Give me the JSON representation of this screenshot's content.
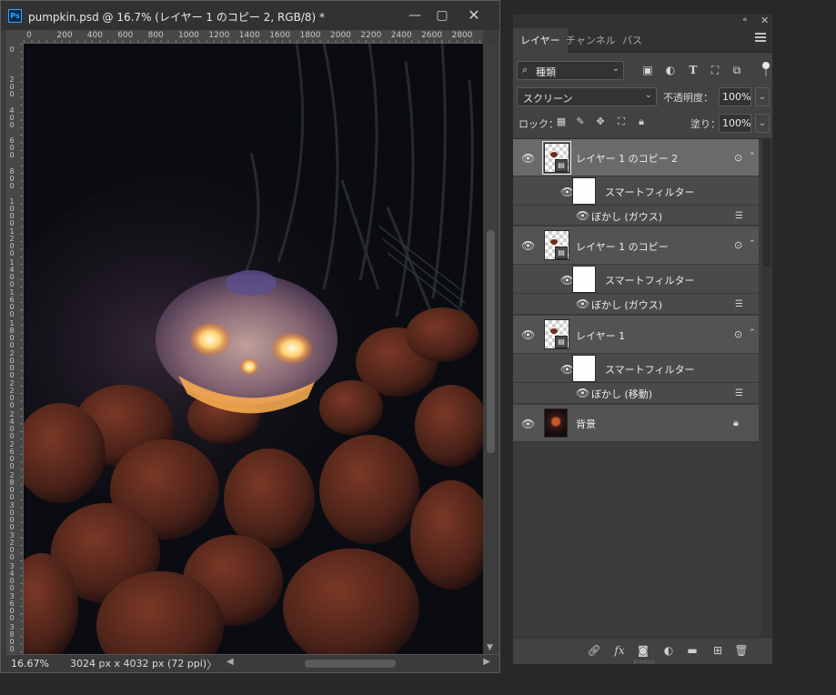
{
  "document": {
    "title": "pumpkin.psd @ 16.7% (レイヤー 1 のコピー 2, RGB/8) *",
    "app_icon": "Ps",
    "window_buttons": {
      "minimize": "—",
      "maximize": "▢",
      "close": "✕"
    },
    "ruler_h_labels": [
      "0",
      "200",
      "400",
      "600",
      "800",
      "1000",
      "1200",
      "1400",
      "1600",
      "1800",
      "2000",
      "2200",
      "2400",
      "2600",
      "2800"
    ],
    "ruler_v_labels": [
      "0",
      "200",
      "400",
      "600",
      "800",
      "1000",
      "1200",
      "1400",
      "1600",
      "1800",
      "2000",
      "2200",
      "2400",
      "2600",
      "2800",
      "3000",
      "3200",
      "3400",
      "3600",
      "3800"
    ],
    "zoom": "16.67%",
    "info": "3024 px x 4032 px (72 ppi)",
    "status_arrow": "〉"
  },
  "panel": {
    "collapse": "«",
    "close": "✕",
    "tabs": [
      "レイヤー",
      "チャンネル",
      "パス"
    ],
    "filter_kind": "種類",
    "filter_icons": [
      "image-filter-icon",
      "adjustment-filter-icon",
      "type-filter-icon",
      "shape-filter-icon",
      "smart-object-filter-icon"
    ],
    "blend_mode": "スクリーン",
    "opacity_label": "不透明度：",
    "opacity_value": "100%",
    "lock_label": "ロック：",
    "fill_label": "塗り：",
    "fill_value": "100%"
  },
  "layers": [
    {
      "name": "レイヤー 1 のコピー 2",
      "selected": true,
      "smart_filter": "スマートフィルター",
      "filter": "ぼかし (ガウス)"
    },
    {
      "name": "レイヤー 1 のコピー",
      "selected": false,
      "smart_filter": "スマートフィルター",
      "filter": "ぼかし (ガウス)"
    },
    {
      "name": "レイヤー 1",
      "selected": false,
      "smart_filter": "スマートフィルター",
      "filter": "ぼかし (移動)"
    },
    {
      "name": "背景",
      "selected": false,
      "locked": true
    }
  ],
  "colors": {
    "app_bg": "#282828",
    "panel_bg": "#424242",
    "selected_row": "#6a6a6a",
    "accent": "#31a8ff"
  }
}
